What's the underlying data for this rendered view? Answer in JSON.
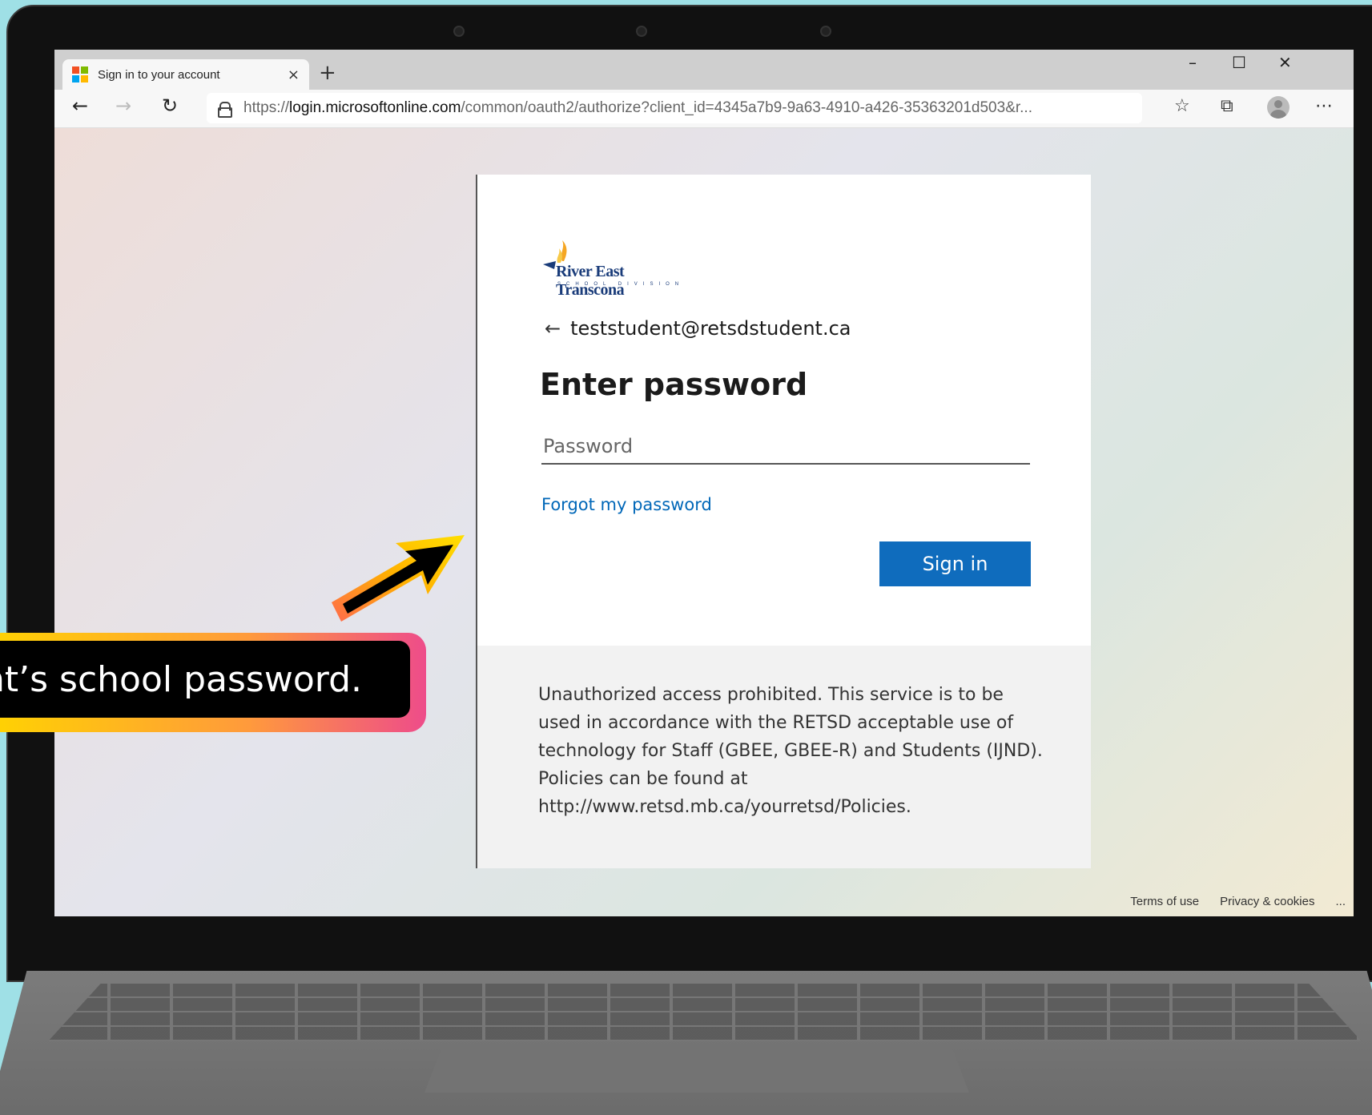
{
  "browser": {
    "tab_title": "Sign in to your account",
    "tab_close": "×",
    "new_tab": "+",
    "minimize": "–",
    "maximize": "☐",
    "close": "✕",
    "url_prefix": "https://",
    "url_domain": "login.microsoftonline.com",
    "url_path": "/common/oauth2/authorize?client_id=4345a7b9-9a63-4910-a426-35363201d503&r..."
  },
  "icons": {
    "back": "back-arrow-icon",
    "forward": "forward-arrow-icon",
    "refresh": "refresh-icon",
    "lock": "lock-icon",
    "favorites": "favorites-icon",
    "collections": "collections-icon",
    "profile": "profile-icon",
    "more": "more-icon"
  },
  "signin": {
    "org_name": "River East Transcona",
    "org_sub": "SCHOOL DIVISION",
    "email": "teststudent@retsdstudent.ca",
    "heading": "Enter password",
    "password_placeholder": "Password",
    "forgot_link": "Forgot my password",
    "button_label": "Sign in",
    "notice": "Unauthorized access prohibited. This service is to be used in accordance with the RETSD acceptable use of technology for Staff (GBEE, GBEE-R) and Students (IJND). Policies can be found at http://www.retsd.mb.ca/yourretsd/Policies."
  },
  "page_footer": {
    "terms": "Terms of use",
    "privacy": "Privacy & cookies",
    "more": "..."
  },
  "callout": {
    "text": "ent’s school password."
  },
  "colors": {
    "accent": "#0f6cbd",
    "link": "#0067b8",
    "callout_gradient": [
      "#ffd400",
      "#ff9a3c",
      "#ee4c8a"
    ]
  }
}
